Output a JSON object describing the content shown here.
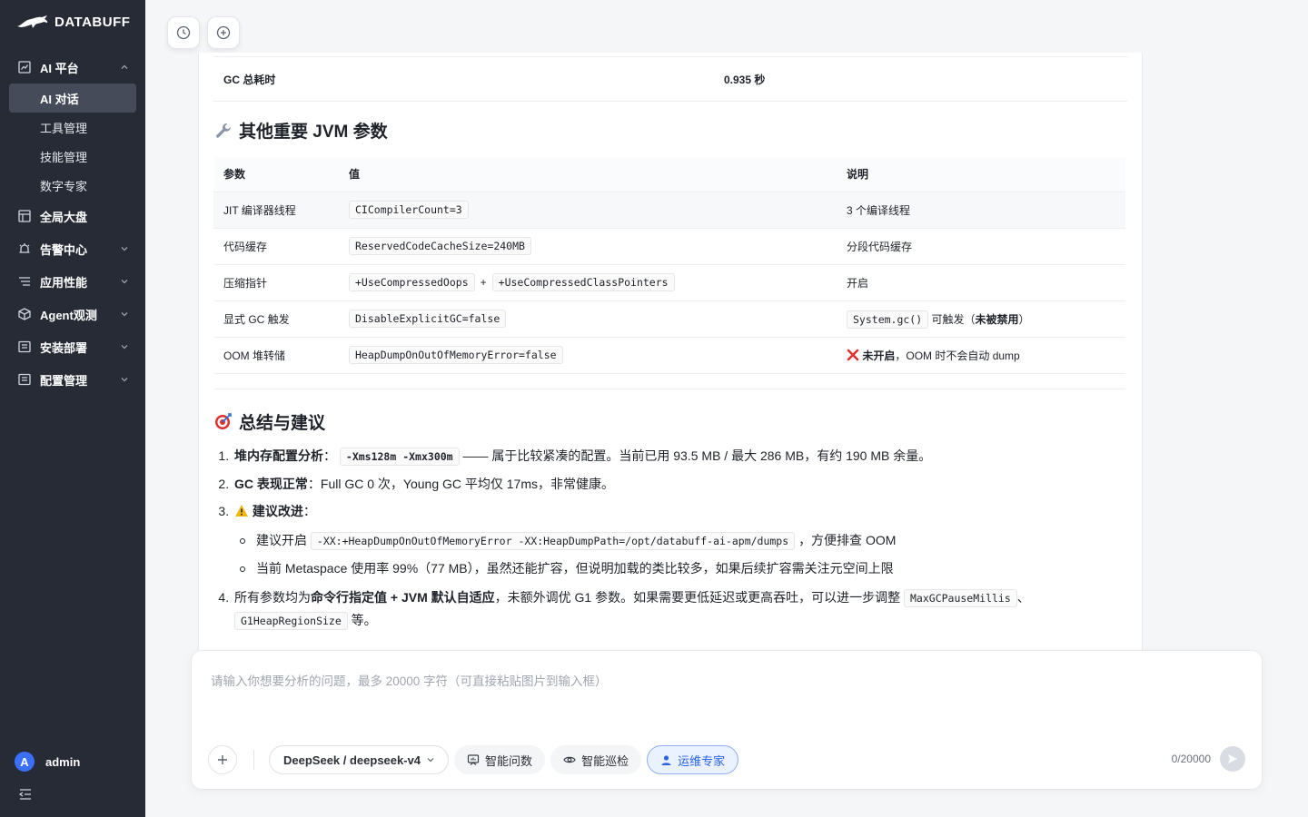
{
  "brand": {
    "name": "DATABUFF"
  },
  "sidebar": {
    "groups": [
      {
        "label": "AI 平台",
        "icon": "chart-icon",
        "expanded": true,
        "items": [
          {
            "label": "AI 对话",
            "active": true
          },
          {
            "label": "工具管理"
          },
          {
            "label": "技能管理"
          },
          {
            "label": "数字专家"
          }
        ]
      },
      {
        "label": "全局大盘",
        "icon": "dashboard-icon"
      },
      {
        "label": "告警中心",
        "icon": "alarm-icon"
      },
      {
        "label": "应用性能",
        "icon": "performance-icon"
      },
      {
        "label": "Agent观测",
        "icon": "cube-icon"
      },
      {
        "label": "安装部署",
        "icon": "install-icon"
      },
      {
        "label": "配置管理",
        "icon": "config-icon"
      }
    ],
    "user": {
      "initial": "A",
      "name": "admin"
    }
  },
  "content": {
    "gc_row": {
      "label": "GC 总耗时",
      "value": "0.935 秒"
    },
    "jvm_section": {
      "title": "其他重要 JVM 参数",
      "icon": "wrench-icon",
      "headers": [
        "参数",
        "值",
        "说明"
      ],
      "rows": [
        {
          "param": "JIT 编译器线程",
          "values": [
            "CICompilerCount=3"
          ],
          "desc": "3 个编译线程"
        },
        {
          "param": "代码缓存",
          "values": [
            "ReservedCodeCacheSize=240MB"
          ],
          "desc": "分段代码缓存"
        },
        {
          "param": "压缩指针",
          "values": [
            "+UseCompressedOops",
            "+UseCompressedClassPointers"
          ],
          "joiner": "+",
          "desc": "开启"
        },
        {
          "param": "显式 GC 触发",
          "values": [
            "DisableExplicitGC=false"
          ],
          "desc_code": "System.gc()",
          "desc": "可触发（",
          "desc_bold": "未被禁用",
          "desc_tail": "）"
        },
        {
          "param": "OOM 堆转储",
          "values": [
            "HeapDumpOnOutOfMemoryError=false"
          ],
          "desc_bold": "未开启",
          "desc": "，OOM 时不会自动 dump"
        }
      ]
    },
    "summary": {
      "title": "总结与建议",
      "icon": "target-icon",
      "items": {
        "i1_bold": "堆内存配置分析",
        "i1_sep": "：",
        "i1_code": "-Xms128m -Xmx300m",
        "i1_text": "—— 属于比较紧凑的配置。当前已用 93.5 MB / 最大 286 MB，有约 190 MB 余量。",
        "i2_bold": "GC 表现正常",
        "i2_text": "：Full GC 0 次，Young GC 平均仅 17ms，非常健康。",
        "i3_bold": "建议改进",
        "i3_sep": "：",
        "i3_sub1_pre": "建议开启",
        "i3_sub1_code": "-XX:+HeapDumpOnOutOfMemoryError -XX:HeapDumpPath=/opt/databuff-ai-apm/dumps",
        "i3_sub1_post": "，方便排查 OOM",
        "i3_sub2": "当前 Metaspace 使用率 99%（77 MB），虽然还能扩容，但说明加载的类比较多，如果后续扩容需关注元空间上限",
        "i4_pre": "所有参数均为",
        "i4_bold": "命令行指定值 + JVM 默认自适应",
        "i4_mid": "，未额外调优 G1 参数。如果需要更低延迟或更高吞吐，可以进一步调整",
        "i4_code1": "MaxGCPauseMillis",
        "i4_sep": "、",
        "i4_code2": "G1HeapRegionSize",
        "i4_end": "等。"
      }
    }
  },
  "composer": {
    "placeholder": "请输入你想要分析的问题，最多 20000 字符（可直接粘贴图片到输入框）",
    "model": "DeepSeek / deepseek-v4",
    "modes": [
      "智能问数",
      "智能巡检",
      "运维专家"
    ],
    "active_mode": "运维专家",
    "counter": "0/20000"
  },
  "colors": {
    "sidebar_bg": "#262b36",
    "accent": "#3a6ff7",
    "danger": "#e0302e",
    "warning": "#f2b705"
  }
}
